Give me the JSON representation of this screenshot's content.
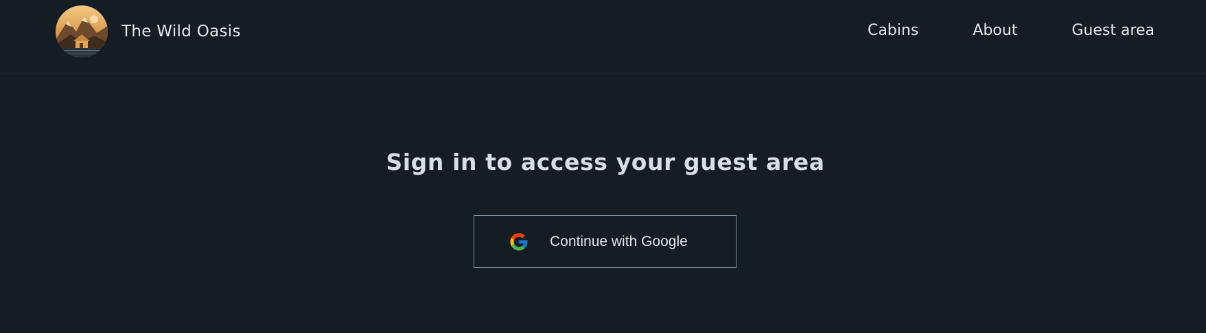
{
  "header": {
    "brand": "The Wild Oasis",
    "nav": [
      {
        "label": "Cabins"
      },
      {
        "label": "About"
      },
      {
        "label": "Guest area"
      }
    ]
  },
  "main": {
    "title": "Sign in to access your guest area",
    "signin_button": {
      "label": "Continue with Google",
      "icon": "google-icon"
    }
  },
  "colors": {
    "background": "#141c24",
    "text": "#e4e8ee",
    "button_border": "#7f90a3"
  }
}
